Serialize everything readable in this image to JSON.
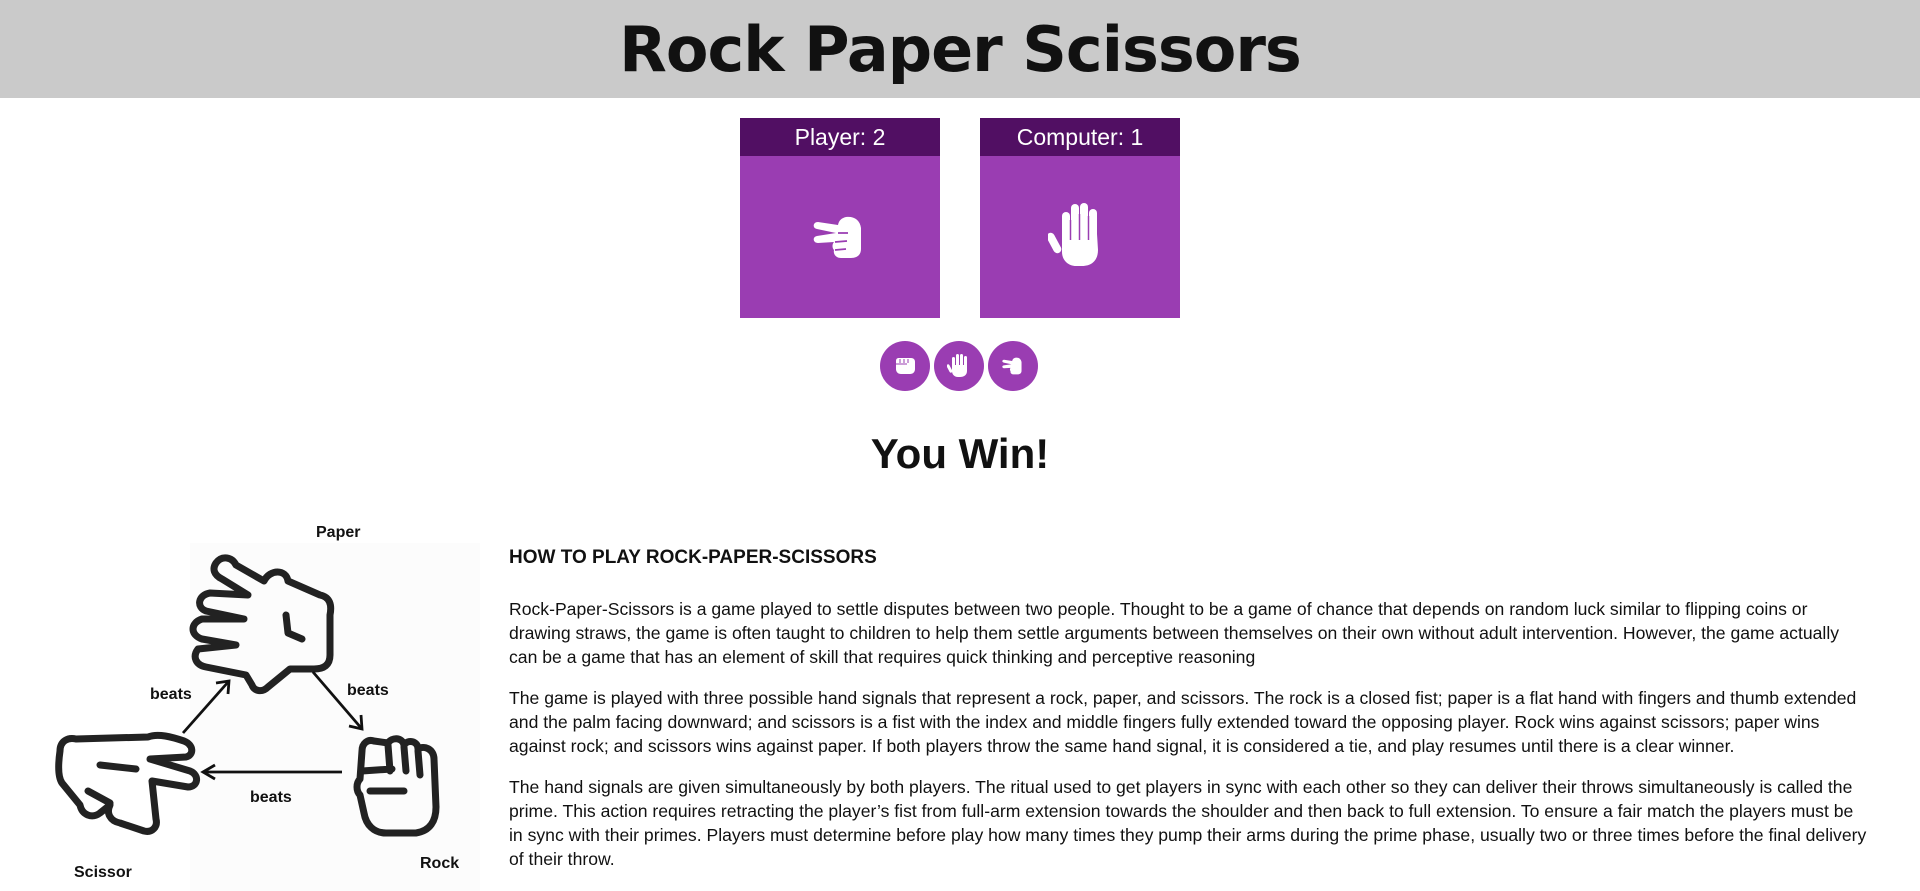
{
  "header": {
    "title": "Rock Paper Scissors"
  },
  "scoreboard": {
    "player": {
      "label": "Player: 2",
      "choice_icon": "scissors-hand-icon"
    },
    "computer": {
      "label": "Computer: 1",
      "choice_icon": "paper-hand-icon"
    }
  },
  "choices": [
    {
      "name": "rock",
      "icon": "rock-fist-icon"
    },
    {
      "name": "paper",
      "icon": "paper-hand-icon"
    },
    {
      "name": "scissors",
      "icon": "scissors-hand-icon"
    }
  ],
  "result": {
    "text": "You Win!"
  },
  "diagram": {
    "paper_label": "Paper",
    "rock_label": "Rock",
    "scissor_label": "Scissor",
    "beats_label": "beats"
  },
  "howto": {
    "heading": "HOW TO PLAY ROCK-PAPER-SCISSORS",
    "paragraphs": [
      "Rock-Paper-Scissors is a game played to settle disputes between two people. Thought to be a game of chance that depends on random luck similar to flipping coins or drawing straws, the game is often taught to children to help them settle arguments between themselves on their own without adult intervention. However, the game actually can be a game that has an element of skill that requires quick thinking and perceptive reasoning",
      "The game is played with three possible hand signals that represent a rock, paper, and scissors. The rock is a closed fist; paper is a flat hand with fingers and thumb extended and the palm facing downward; and scissors is a fist with the index and middle fingers fully extended toward the opposing player. Rock wins against scissors; paper wins against rock; and scissors wins against paper. If both players throw the same hand signal, it is considered a tie, and play resumes until there is a clear winner.",
      "The hand signals are given simultaneously by both players. The ritual used to get players in sync with each other so they can deliver their throws simultaneously is called the prime. This action requires retracting the player’s fist from full-arm extension towards the shoulder and then back to full extension. To ensure a fair match the players must be in sync with their primes. Players must determine before play how many times they pump their arms during the prime phase, usually two or three times before the final delivery of their throw."
    ]
  },
  "colors": {
    "header_bg": "#cacaca",
    "card_bg": "#9a3db2",
    "card_title_bg": "#510f63",
    "icon": "#ffffff"
  }
}
